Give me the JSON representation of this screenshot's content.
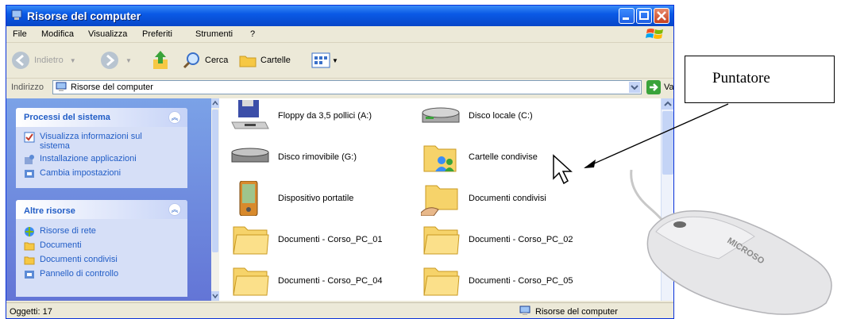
{
  "window": {
    "title": "Risorse del computer",
    "menu": [
      "File",
      "Modifica",
      "Visualizza",
      "Preferiti",
      "Strumenti",
      "?"
    ],
    "toolbar": {
      "back": "Indietro",
      "search": "Cerca",
      "folders": "Cartelle"
    },
    "address": {
      "label": "Indirizzo",
      "value": "Risorse del computer",
      "go": "Vai"
    }
  },
  "tasks": {
    "system": {
      "title": "Processi del sistema",
      "links": [
        "Visualizza informazioni sul sistema",
        "Installazione applicazioni",
        "Cambia impostazioni"
      ]
    },
    "other": {
      "title": "Altre risorse",
      "links": [
        "Risorse di rete",
        "Documenti",
        "Documenti condivisi",
        "Pannello di controllo"
      ]
    }
  },
  "files": [
    {
      "label": "Floppy da 3,5 pollici (A:)",
      "icon": "floppy-drive-icon"
    },
    {
      "label": "Disco locale (C:)",
      "icon": "hard-disk-icon"
    },
    {
      "label": "Disco rimovibile (G:)",
      "icon": "removable-disk-icon"
    },
    {
      "label": "Cartelle condivise",
      "icon": "shared-folders-icon"
    },
    {
      "label": "Dispositivo portatile",
      "icon": "portable-device-icon"
    },
    {
      "label": "Documenti condivisi",
      "icon": "shared-documents-icon"
    },
    {
      "label": "Documenti - Corso_PC_01",
      "icon": "folder-icon"
    },
    {
      "label": "Documenti - Corso_PC_02",
      "icon": "folder-icon"
    },
    {
      "label": "Documenti - Corso_PC_04",
      "icon": "folder-icon"
    },
    {
      "label": "Documenti - Corso_PC_05",
      "icon": "folder-icon"
    }
  ],
  "status": {
    "count": "Oggetti: 17",
    "location": "Risorse del computer"
  },
  "callout": "Puntatore",
  "mouse_brand": "MICROSO",
  "colors": {
    "xp_blue": "#0a5ae6",
    "task_blue": "#215dc6",
    "pane_bg": "#6375d6"
  }
}
